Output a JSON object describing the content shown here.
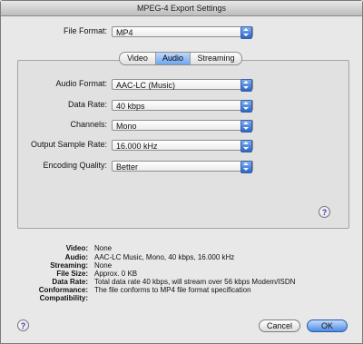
{
  "window": {
    "title": "MPEG-4 Export Settings"
  },
  "file_format": {
    "label": "File Format:",
    "value": "MP4"
  },
  "tabs": [
    {
      "label": "Video"
    },
    {
      "label": "Audio"
    },
    {
      "label": "Streaming"
    }
  ],
  "audio": {
    "format": {
      "label": "Audio Format:",
      "value": "AAC-LC (Music)"
    },
    "data_rate": {
      "label": "Data Rate:",
      "value": "40 kbps"
    },
    "channels": {
      "label": "Channels:",
      "value": "Mono"
    },
    "sample_rate": {
      "label": "Output Sample Rate:",
      "value": "16.000 kHz"
    },
    "quality": {
      "label": "Encoding Quality:",
      "value": "Better"
    }
  },
  "summary": {
    "video": {
      "label": "Video:",
      "value": "None"
    },
    "audio": {
      "label": "Audio:",
      "value": "AAC-LC Music, Mono, 40 kbps, 16.000 kHz"
    },
    "streaming": {
      "label": "Streaming:",
      "value": "None"
    },
    "file_size": {
      "label": "File Size:",
      "value": "Approx. 0 KB"
    },
    "data_rate": {
      "label": "Data Rate:",
      "value": "Total data rate 40 kbps, will stream over 56 kbps Modem/ISDN"
    },
    "conformance": {
      "label": "Conformance:",
      "value": "The file conforms to MP4 file format specification"
    },
    "compatibility": {
      "label": "Compatibility:",
      "value": ""
    }
  },
  "buttons": {
    "cancel": "Cancel",
    "ok": "OK",
    "help": "?"
  },
  "colors": {
    "accent": "#4d8be6",
    "help_glyph": "#4a2aa0"
  }
}
